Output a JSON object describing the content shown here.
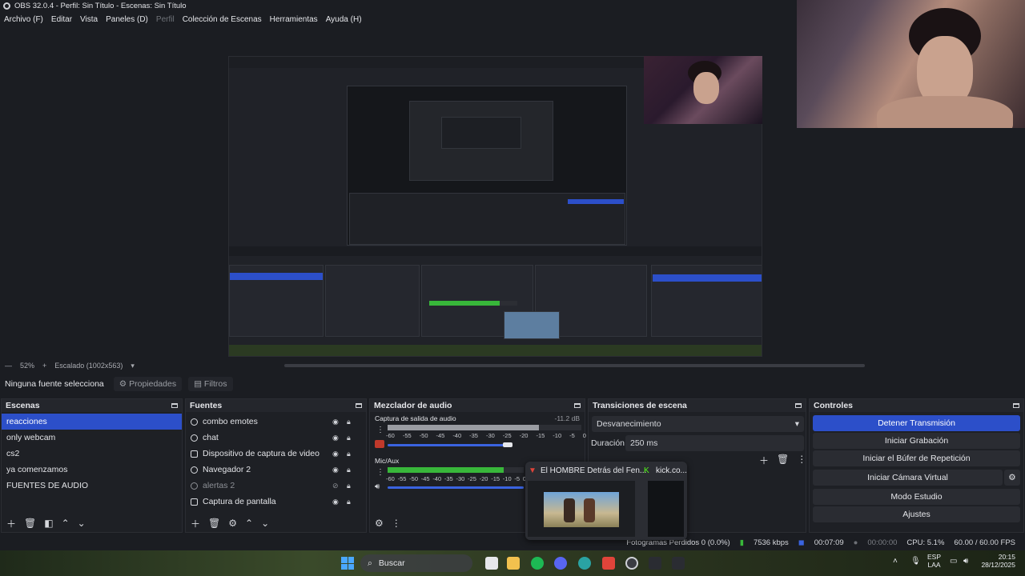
{
  "window": {
    "title": "OBS 32.0.4 - Perfil: Sin Título - Escenas: Sin Título"
  },
  "menu": [
    "Archivo (F)",
    "Editar",
    "Vista",
    "Paneles (D)",
    "Perfil",
    "Colección de Escenas",
    "Herramientas",
    "Ayuda (H)"
  ],
  "preview": {
    "zoom": "52%",
    "plus": "+",
    "scaled": "Escalado (1002x563)",
    "minus": "—"
  },
  "propbar": {
    "no_source": "Ninguna fuente selecciona",
    "properties": "Propiedades",
    "filters": "Filtros"
  },
  "scenes": {
    "title": "Escenas",
    "items": [
      "reacciones",
      "only webcam",
      "cs2",
      "ya comenzamos",
      "FUENTES DE AUDIO"
    ],
    "selected_index": 0
  },
  "sources": {
    "title": "Fuentes",
    "items": [
      {
        "label": "combo emotes",
        "icon": "browser-icon",
        "visible": true
      },
      {
        "label": "chat",
        "icon": "browser-icon",
        "visible": true
      },
      {
        "label": "Dispositivo de captura de video",
        "icon": "camera-icon",
        "visible": true
      },
      {
        "label": "Navegador 2",
        "icon": "browser-icon",
        "visible": true
      },
      {
        "label": "alertas 2",
        "icon": "browser-icon",
        "visible": false
      },
      {
        "label": "Captura de pantalla",
        "icon": "monitor-icon",
        "visible": true
      }
    ]
  },
  "mixer": {
    "title": "Mezclador de audio",
    "tracks": [
      {
        "name": "Captura de salida de audio",
        "db": "-11.2 dB",
        "level": 0.78,
        "volume": 0.82
      },
      {
        "name": "Mic/Aux",
        "db": "",
        "level": 0.85,
        "volume": 0.75
      }
    ],
    "scale": [
      "-60",
      "-55",
      "-50",
      "-45",
      "-40",
      "-35",
      "-30",
      "-25",
      "-20",
      "-15",
      "-10",
      "-5",
      "0"
    ]
  },
  "transitions": {
    "title": "Transiciones de escena",
    "selected": "Desvanecimiento",
    "duration_label": "Duración",
    "duration_value": "250 ms"
  },
  "controls": {
    "title": "Controles",
    "buttons": [
      "Detener Transmisión",
      "Iniciar Grabación",
      "Iniciar el Búfer de Repetición",
      "Iniciar Cámara Virtual",
      "Modo Estudio",
      "Ajustes"
    ]
  },
  "status": {
    "dropped": "Fotogramas Perdidos 0 (0.0%)",
    "bitrate": "7536 kbps",
    "stream_time": "00:07:09",
    "record_time": "00:00:00",
    "cpu": "CPU: 5.1%",
    "fps": "60.00 / 60.00 FPS"
  },
  "thumbnail": {
    "tab1": "El HOMBRE Detrás del Fen...",
    "tab2": "kick.co..."
  },
  "taskbar": {
    "search": "Buscar",
    "lang_top": "ESP",
    "lang_bottom": "LAA",
    "time": "20:15",
    "date": "28/12/2025"
  },
  "colors": {
    "accent": "#2c4fc9",
    "meter_green": "#38b73a",
    "bg": "#1b1d22"
  }
}
